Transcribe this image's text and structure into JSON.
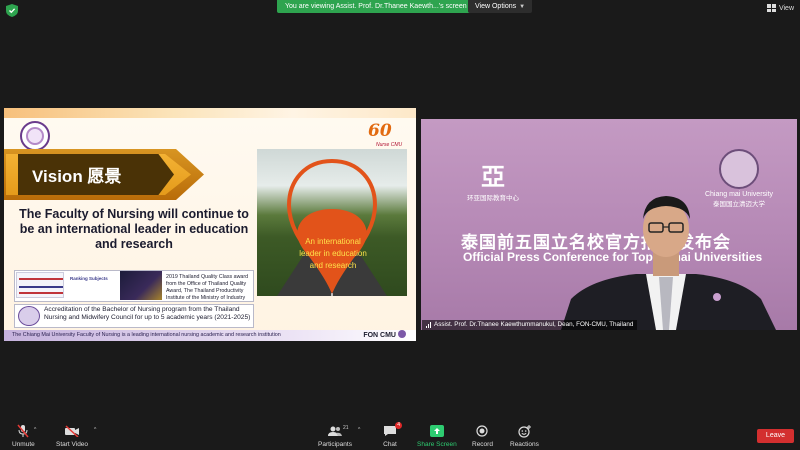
{
  "topbar": {
    "viewing_banner": "You are viewing Assist. Prof. Dr.Thanee Kaewth...'s screen",
    "view_options": "View Options",
    "view_label": "View"
  },
  "slide": {
    "vision_title": "Vision 愿景",
    "anniv_number": "60",
    "anniv_sub": "Nurse CMU",
    "statement": "The Faculty of Nursing will continue to be an international leader in education and research",
    "pin_text": "An international leader in education and research",
    "ranking_label": "Ranking Subjects",
    "award_caption": "2019 Thailand Quality Class award from the Office of Thailand Quality Award, The Thailand Productivity Institute of the Ministry of Industry",
    "accreditation": "Accreditation of the Bachelor of Nursing program from the Thailand Nursing and Midwifery Council for up to 5 academic years (2021-2025)",
    "footer": "The Chiang Mai University Faculty of Nursing is a leading international nursing academic and research institution",
    "fon_cmu": "FON CMU"
  },
  "video": {
    "org_logo_caption": "环亚国际教育中心",
    "cmu_name": "Chiang mai University",
    "cmu_cn": "泰国国立清迈大学",
    "press_cn": "泰国前五国立名校官方招生发布会",
    "press_en": "Official Press Conference for Top 5 Thai Universities",
    "speaker_name": "Assist. Prof. Dr.Thanee Kaewthummanukul, Dean, FON-CMU, Thailand"
  },
  "toolbar": {
    "unmute": "Unmute",
    "start_video": "Start Video",
    "participants": "Participants",
    "participants_count": "21",
    "chat": "Chat",
    "chat_badge": "4",
    "share_screen": "Share Screen",
    "record": "Record",
    "reactions": "Reactions",
    "leave": "Leave"
  },
  "colors": {
    "share_green": "#2ecc71",
    "banner_green": "#2ea44f",
    "leave_red": "#d32f2f",
    "video_purple": "#b78ab6",
    "vision_gold": "#e59b1b"
  }
}
